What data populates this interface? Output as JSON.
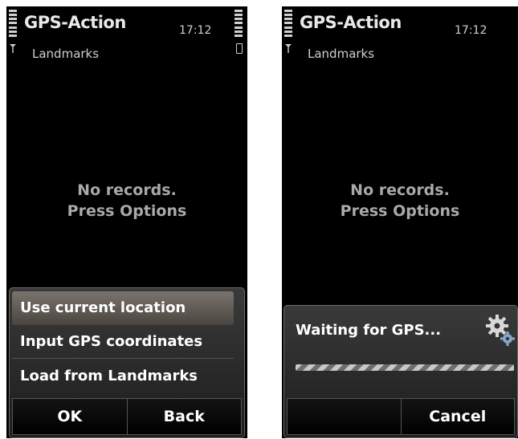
{
  "screens": [
    {
      "app_title": "GPS-Action",
      "clock": "17:12",
      "view_title": "Landmarks",
      "empty_line1": "No records.",
      "empty_line2": "Press Options",
      "menu_items": [
        {
          "label": "Use current location"
        },
        {
          "label": "Input GPS coordinates"
        },
        {
          "label": "Load from Landmarks"
        }
      ],
      "softkeys": {
        "left": "OK",
        "right": "Back"
      }
    },
    {
      "app_title": "GPS-Action",
      "clock": "17:12",
      "view_title": "Landmarks",
      "empty_line1": "No records.",
      "empty_line2": "Press Options",
      "wait_message": "Waiting for GPS...",
      "softkeys": {
        "left": "",
        "right": "Cancel"
      }
    }
  ],
  "icons": {
    "signal": "signal-strength-icon",
    "battery": "battery-level-icon",
    "antenna": "antenna-icon",
    "battery_small": "battery-icon",
    "busy": "gears-icon"
  },
  "colors": {
    "background": "#000000",
    "text": "#ffffff",
    "muted_text": "#a9a9a9",
    "selection": "#6a625b"
  }
}
